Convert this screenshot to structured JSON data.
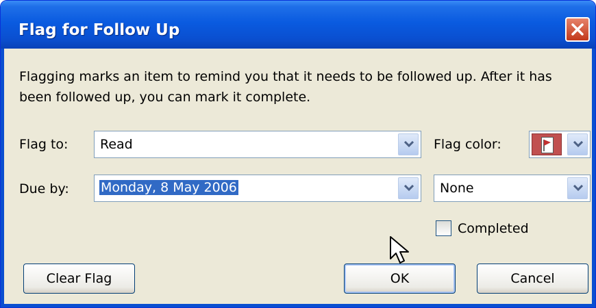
{
  "window": {
    "title": "Flag for Follow Up"
  },
  "message": "Flagging marks an item to remind you that it needs to be followed up.  After it has been followed up, you can mark it complete.",
  "flag_to": {
    "label": "Flag to:",
    "value": "Read"
  },
  "flag_color": {
    "label": "Flag color:",
    "color": "#c15050"
  },
  "due_by": {
    "label": "Due by:",
    "date": "Monday, 8 May 2006",
    "time": "None"
  },
  "completed": {
    "label": "Completed",
    "checked": false
  },
  "buttons": {
    "clear_flag": "Clear Flag",
    "ok": "OK",
    "cancel": "Cancel"
  },
  "colors": {
    "titlebar": "#0a5be0",
    "dialog_bg": "#ece9d8",
    "selection": "#316ac5",
    "close": "#c2381a"
  }
}
